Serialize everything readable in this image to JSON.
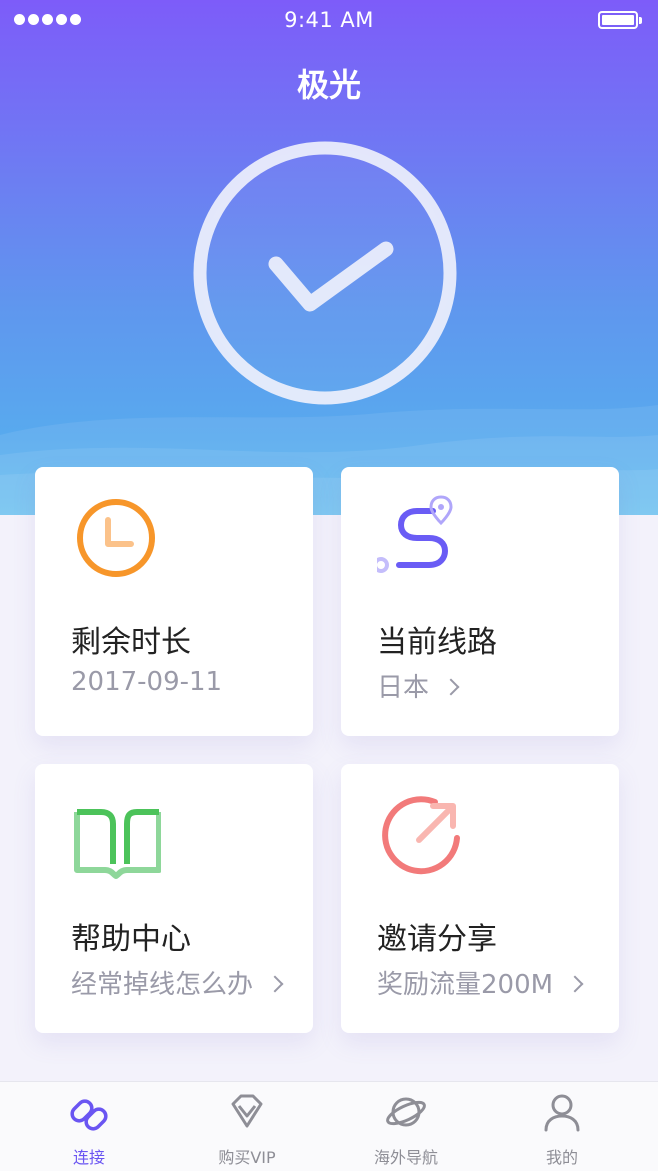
{
  "status_bar": {
    "time": "9:41 AM"
  },
  "header": {
    "title": "极光"
  },
  "cards": [
    {
      "label": "剩余时长",
      "sub": "2017-09-11",
      "icon": "clock-icon"
    },
    {
      "label": "当前线路",
      "sub": "日本",
      "icon": "route-icon"
    },
    {
      "label": "帮助中心",
      "sub": "经常掉线怎么办",
      "icon": "book-icon"
    },
    {
      "label": "邀请分享",
      "sub": "奖励流量200M",
      "icon": "share-icon"
    }
  ],
  "tabs": [
    {
      "label": "连接",
      "icon": "link-icon",
      "active": true
    },
    {
      "label": "购买VIP",
      "icon": "diamond-icon",
      "active": false
    },
    {
      "label": "海外导航",
      "icon": "planet-icon",
      "active": false
    },
    {
      "label": "我的",
      "icon": "user-icon",
      "active": false
    }
  ],
  "colors": {
    "accent": "#6a55f2",
    "gradient_top": "#7d5cf9",
    "gradient_bottom": "#5fbbee",
    "clock_icon": "#f7962a",
    "route_icon": "#6a5cf5",
    "book_icon": "#4cc35a",
    "share_icon": "#f27a7a"
  }
}
